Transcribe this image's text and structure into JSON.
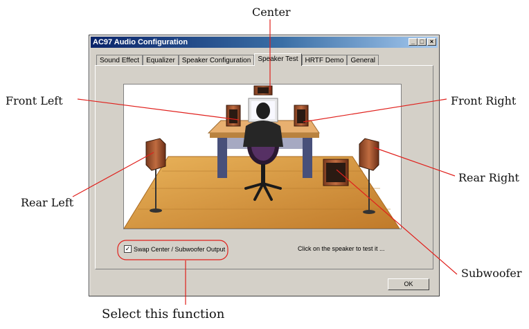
{
  "window": {
    "title": "AC97 Audio Configuration",
    "controls": {
      "minimize": "_",
      "maximize": "□",
      "close": "×"
    },
    "tabs": [
      {
        "label": "Sound Effect",
        "active": false
      },
      {
        "label": "Equalizer",
        "active": false
      },
      {
        "label": "Speaker Configuration",
        "active": false
      },
      {
        "label": "Speaker Test",
        "active": true
      },
      {
        "label": "HRTF Demo",
        "active": false
      },
      {
        "label": "General",
        "active": false
      }
    ],
    "checkbox": {
      "label": "Swap Center / Subwoofer Output",
      "checked": true
    },
    "hint": "Click on the speaker to test it ...",
    "ok_label": "OK"
  },
  "callouts": {
    "center": "Center",
    "front_left": "Front Left",
    "front_right": "Front Right",
    "rear_left": "Rear Left",
    "rear_right": "Rear Right",
    "subwoofer": "Subwoofer",
    "select_function": "Select this function"
  },
  "colors": {
    "callout_line": "#e0201c",
    "titlebar": "#0a246a",
    "floor": "#d89a3c",
    "speaker": "#9c5130"
  }
}
